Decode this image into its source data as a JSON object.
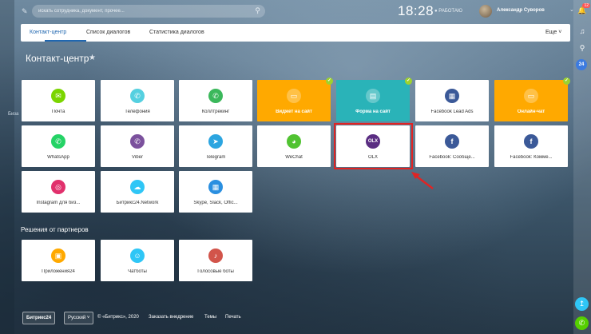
{
  "search": {
    "placeholder": "искать сотрудника, документ, прочее..."
  },
  "header": {
    "time": "18:28",
    "status": "РАБОТАЮ",
    "user_name": "Александр Суворов"
  },
  "left_strip": {
    "label": "Биза"
  },
  "right_bar": {
    "notifications_count": "12",
    "badge": "24"
  },
  "tabs": {
    "items": [
      "Контакт-центр",
      "Список диалогов",
      "Статистика диалогов"
    ],
    "more": "Еще"
  },
  "page": {
    "title": "Контакт-центр"
  },
  "tiles": [
    {
      "label": "Почта",
      "icon": "mail-icon",
      "color": "#7bd500"
    },
    {
      "label": "Телефония",
      "icon": "phone-icon",
      "color": "#55d0e0"
    },
    {
      "label": "Коллтрекинг",
      "icon": "calltracking-icon",
      "color": "#3bb85b"
    },
    {
      "label": "Виджет на сайт",
      "icon": "chat-widget-icon",
      "color": "#ffa900"
    },
    {
      "label": "Форма на сайт",
      "icon": "form-icon",
      "color": "#2ab3b8"
    },
    {
      "label": "Facebook Lead Ads",
      "icon": "facebook-lead-icon",
      "color": "#3b5998"
    },
    {
      "label": "Онлайн-чат",
      "icon": "online-chat-icon",
      "color": "#ffa900"
    },
    {
      "label": "WhatsApp",
      "icon": "whatsapp-icon",
      "color": "#25d366"
    },
    {
      "label": "Viber",
      "icon": "viber-icon",
      "color": "#7b519d"
    },
    {
      "label": "Telegram",
      "icon": "telegram-icon",
      "color": "#2ca5e0"
    },
    {
      "label": "WeChat",
      "icon": "wechat-icon",
      "color": "#51c332"
    },
    {
      "label": "OLX",
      "icon": "olx-icon",
      "color": "#5a2d82"
    },
    {
      "label": "Facebook: Сообще...",
      "icon": "facebook-icon",
      "color": "#3b5998"
    },
    {
      "label": "Facebook: Комме...",
      "icon": "facebook-comments-icon",
      "color": "#3b5998"
    },
    {
      "label": "Instagram для биз...",
      "icon": "instagram-icon",
      "color": "#e1306c"
    },
    {
      "label": "Битрикс24.Network",
      "icon": "network-icon",
      "color": "#2fc6f6"
    },
    {
      "label": "Skype, Slack, Offic...",
      "icon": "apps-icon",
      "color": "#2a8fe0"
    }
  ],
  "partners": {
    "title": "Решения от партнеров",
    "tiles": [
      {
        "label": "Приложения24",
        "icon": "apps24-icon",
        "color": "#ffa900"
      },
      {
        "label": "Чатботы",
        "icon": "chatbot-icon",
        "color": "#2fc6f6"
      },
      {
        "label": "Голосовые боты",
        "icon": "voice-bot-icon",
        "color": "#d2544a"
      }
    ]
  },
  "footer": {
    "brand": "Битрикс24",
    "language": "Русский",
    "copyright": "© «Битрикс», 2020",
    "order": "Заказать внедрение",
    "themes": "Темы",
    "print": "Печать"
  }
}
